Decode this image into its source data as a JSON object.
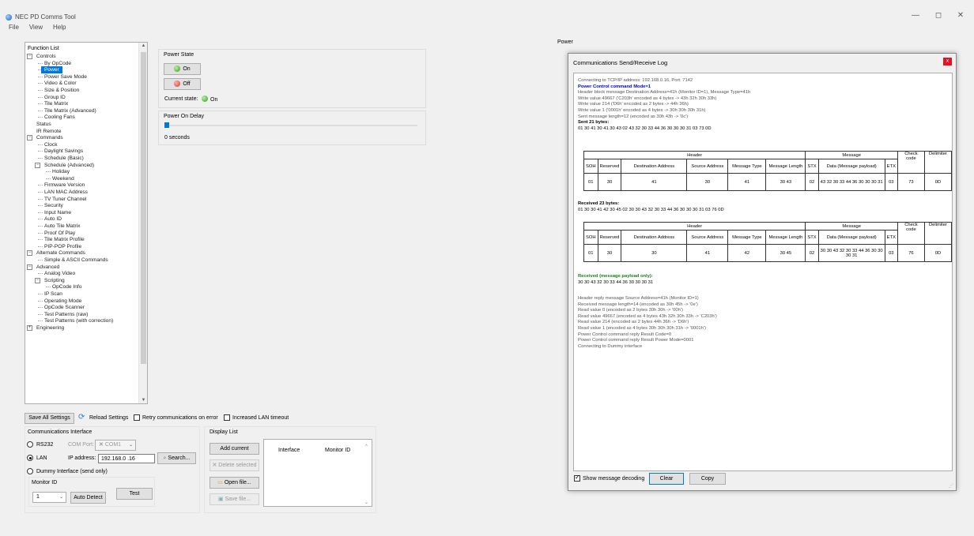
{
  "window": {
    "title": "NEC PD Comms Tool",
    "minimize": "—",
    "maximize": "◻",
    "close": "✕"
  },
  "menu": [
    "File",
    "View",
    "Help"
  ],
  "function_list": {
    "title": "Function List",
    "items": [
      {
        "label": "Controls",
        "level": 0,
        "expander": "−"
      },
      {
        "label": "By OpCode",
        "level": 1
      },
      {
        "label": "Power",
        "level": 1,
        "selected": true
      },
      {
        "label": "Power Save Mode",
        "level": 1
      },
      {
        "label": "Video & Color",
        "level": 1
      },
      {
        "label": "Size & Position",
        "level": 1
      },
      {
        "label": "Group ID",
        "level": 1
      },
      {
        "label": "Tile Matrix",
        "level": 1
      },
      {
        "label": "Tile Matrix (Advanced)",
        "level": 1
      },
      {
        "label": "Cooling Fans",
        "level": 1
      },
      {
        "label": "Status",
        "level": 0
      },
      {
        "label": "IR Remote",
        "level": 0
      },
      {
        "label": "Commands",
        "level": 0,
        "expander": "−"
      },
      {
        "label": "Clock",
        "level": 1
      },
      {
        "label": "Daylight Savings",
        "level": 1
      },
      {
        "label": "Schedule (Basic)",
        "level": 1
      },
      {
        "label": "Schedule (Advanced)",
        "level": 1,
        "expander": "−"
      },
      {
        "label": "Holiday",
        "level": 2
      },
      {
        "label": "Weekend",
        "level": 2
      },
      {
        "label": "Firmware Version",
        "level": 1
      },
      {
        "label": "LAN MAC Address",
        "level": 1
      },
      {
        "label": "TV Tuner Channel",
        "level": 1
      },
      {
        "label": "Security",
        "level": 1
      },
      {
        "label": "Input Name",
        "level": 1
      },
      {
        "label": "Auto ID",
        "level": 1
      },
      {
        "label": "Auto Tile Matrix",
        "level": 1
      },
      {
        "label": "Proof Of Play",
        "level": 1
      },
      {
        "label": "Tile Matrix Profile",
        "level": 1
      },
      {
        "label": "PIP-POP Profile",
        "level": 1
      },
      {
        "label": "Alternate Commands",
        "level": 0,
        "expander": "−"
      },
      {
        "label": "Simple & ASCII Commands",
        "level": 1
      },
      {
        "label": "Advanced",
        "level": 0,
        "expander": "−"
      },
      {
        "label": "Analog Video",
        "level": 1
      },
      {
        "label": "Scripting",
        "level": 1,
        "expander": "−"
      },
      {
        "label": "OpCode Info",
        "level": 2
      },
      {
        "label": "IP Scan",
        "level": 1
      },
      {
        "label": "Operating Mode",
        "level": 1
      },
      {
        "label": "OpCode Scanner",
        "level": 1
      },
      {
        "label": "Test Patterns (raw)",
        "level": 1
      },
      {
        "label": "Test Patterns (with correction)",
        "level": 1
      },
      {
        "label": "Engineering",
        "level": 0,
        "expander": "+"
      }
    ]
  },
  "power_panel": {
    "header": "Power",
    "power_state": {
      "title": "Power State",
      "on_label": "On",
      "off_label": "Off",
      "current_state_label": "Current state:",
      "current_state_value": "On"
    },
    "power_on_delay": {
      "title": "Power On Delay",
      "value_text": "0 seconds",
      "level": 0
    }
  },
  "bottom_bar": {
    "save_all": "Save All Settings",
    "reload": "Reload Settings",
    "retry_label": "Retry communications on error",
    "lan_timeout_label": "Increased LAN timeout"
  },
  "comm_interface": {
    "title": "Communications Interface",
    "rs232_label": "RS232",
    "com_port_label": "COM Port:",
    "com_port_value": "COM1",
    "lan_label": "LAN",
    "ip_label": "IP address:",
    "ip_value": "192.168.0 .16",
    "search_label": "Search...",
    "dummy_label": "Dummy Interface (send only)",
    "monitor_id_label": "Monitor ID",
    "monitor_id_value": "1",
    "auto_detect": "Auto Detect",
    "test": "Test"
  },
  "display_list": {
    "title": "Display List",
    "add_current": "Add current",
    "delete_selected": "Delete selected",
    "open_file": "Open file...",
    "save_file": "Save file...",
    "columns": [
      "Interface",
      "Monitor ID"
    ]
  },
  "log": {
    "title": "Communications Send/Receive Log",
    "lines_top": [
      {
        "text": "Connecting to TCP/IP address: 192.168.0.16, Port: 7142",
        "style": ""
      },
      {
        "text": "Power Control command Mode=1",
        "style": "blue"
      },
      {
        "text": "Header block message Destination Address=41h (Monitor ID=1), Message Type=41h",
        "style": ""
      },
      {
        "text": "Write value 49667 ('C203h' encoded as 4 bytes -> 43h 32h 30h 33h)",
        "style": ""
      },
      {
        "text": "Write value 214 ('D6h' encoded as 2 bytes -> 44h 36h)",
        "style": ""
      },
      {
        "text": "Write value 1 ('0001h' encoded as 4 bytes -> 30h 30h 30h 31h)",
        "style": ""
      },
      {
        "text": "Sent message length=12 (encoded as 30h 43h -> '0c')",
        "style": ""
      },
      {
        "text": "Sent 21 bytes:",
        "style": "bold"
      },
      {
        "text": "01 30 41 30 41 30 43 02 43 32 30 33 44 36 30 30 30 31 03 73 0D",
        "style": "dark"
      }
    ],
    "table_header": {
      "group_header": "Header",
      "group_message": "Message",
      "check_code": "Check code",
      "delimiter": "Delimiter",
      "cols": [
        "SOH",
        "Reserved",
        "Destination Address",
        "Source Address",
        "Message Type",
        "Message Length",
        "STX",
        "Data (Message payload)",
        "ETX"
      ]
    },
    "sent_row": [
      "01",
      "30",
      "41",
      "30",
      "41",
      "30 43",
      "02",
      "43 32 30 33 44 36 30 30 30 31",
      "03",
      "73",
      "0D"
    ],
    "received_title": "Received 23 bytes:",
    "received_bytes": "01 30 30 41 42 30 45 02 30 30 43 32 30 33 44 36 30 30 30 31 03 76 0D",
    "received_row": [
      "01",
      "30",
      "30",
      "41",
      "42",
      "30 45",
      "02",
      "30 30 43 32 30 33 44 36 30 30 30 31",
      "03",
      "76",
      "0D"
    ],
    "payload_title": "Received (message payload only):",
    "payload_bytes": "30 30 43 32 30 33 44 36 30 30 30 31",
    "lines_bottom": [
      "Header reply message Source Address=41h (Monitor ID=1)",
      "Received message length=14 (encoded as 30h 45h -> '0e')",
      "Read value 0 (encoded as 2 bytes 30h 30h -> '00h')",
      "Read value 49667 (encoded as 4 bytes 43h 32h 30h 33h -> 'C203h')",
      "Read value 214 (encoded as 2 bytes 44h 36h -> 'D6h')",
      "Read value 1 (encoded as 4 bytes 30h 30h 30h 31h -> '0001h')",
      "Power Control command reply Result Code=0",
      "Power Control command reply Result Power Mode=0001",
      "Connecting to Dummy interface"
    ],
    "show_decoding_label": "Show message decoding",
    "clear": "Clear",
    "copy": "Copy"
  }
}
